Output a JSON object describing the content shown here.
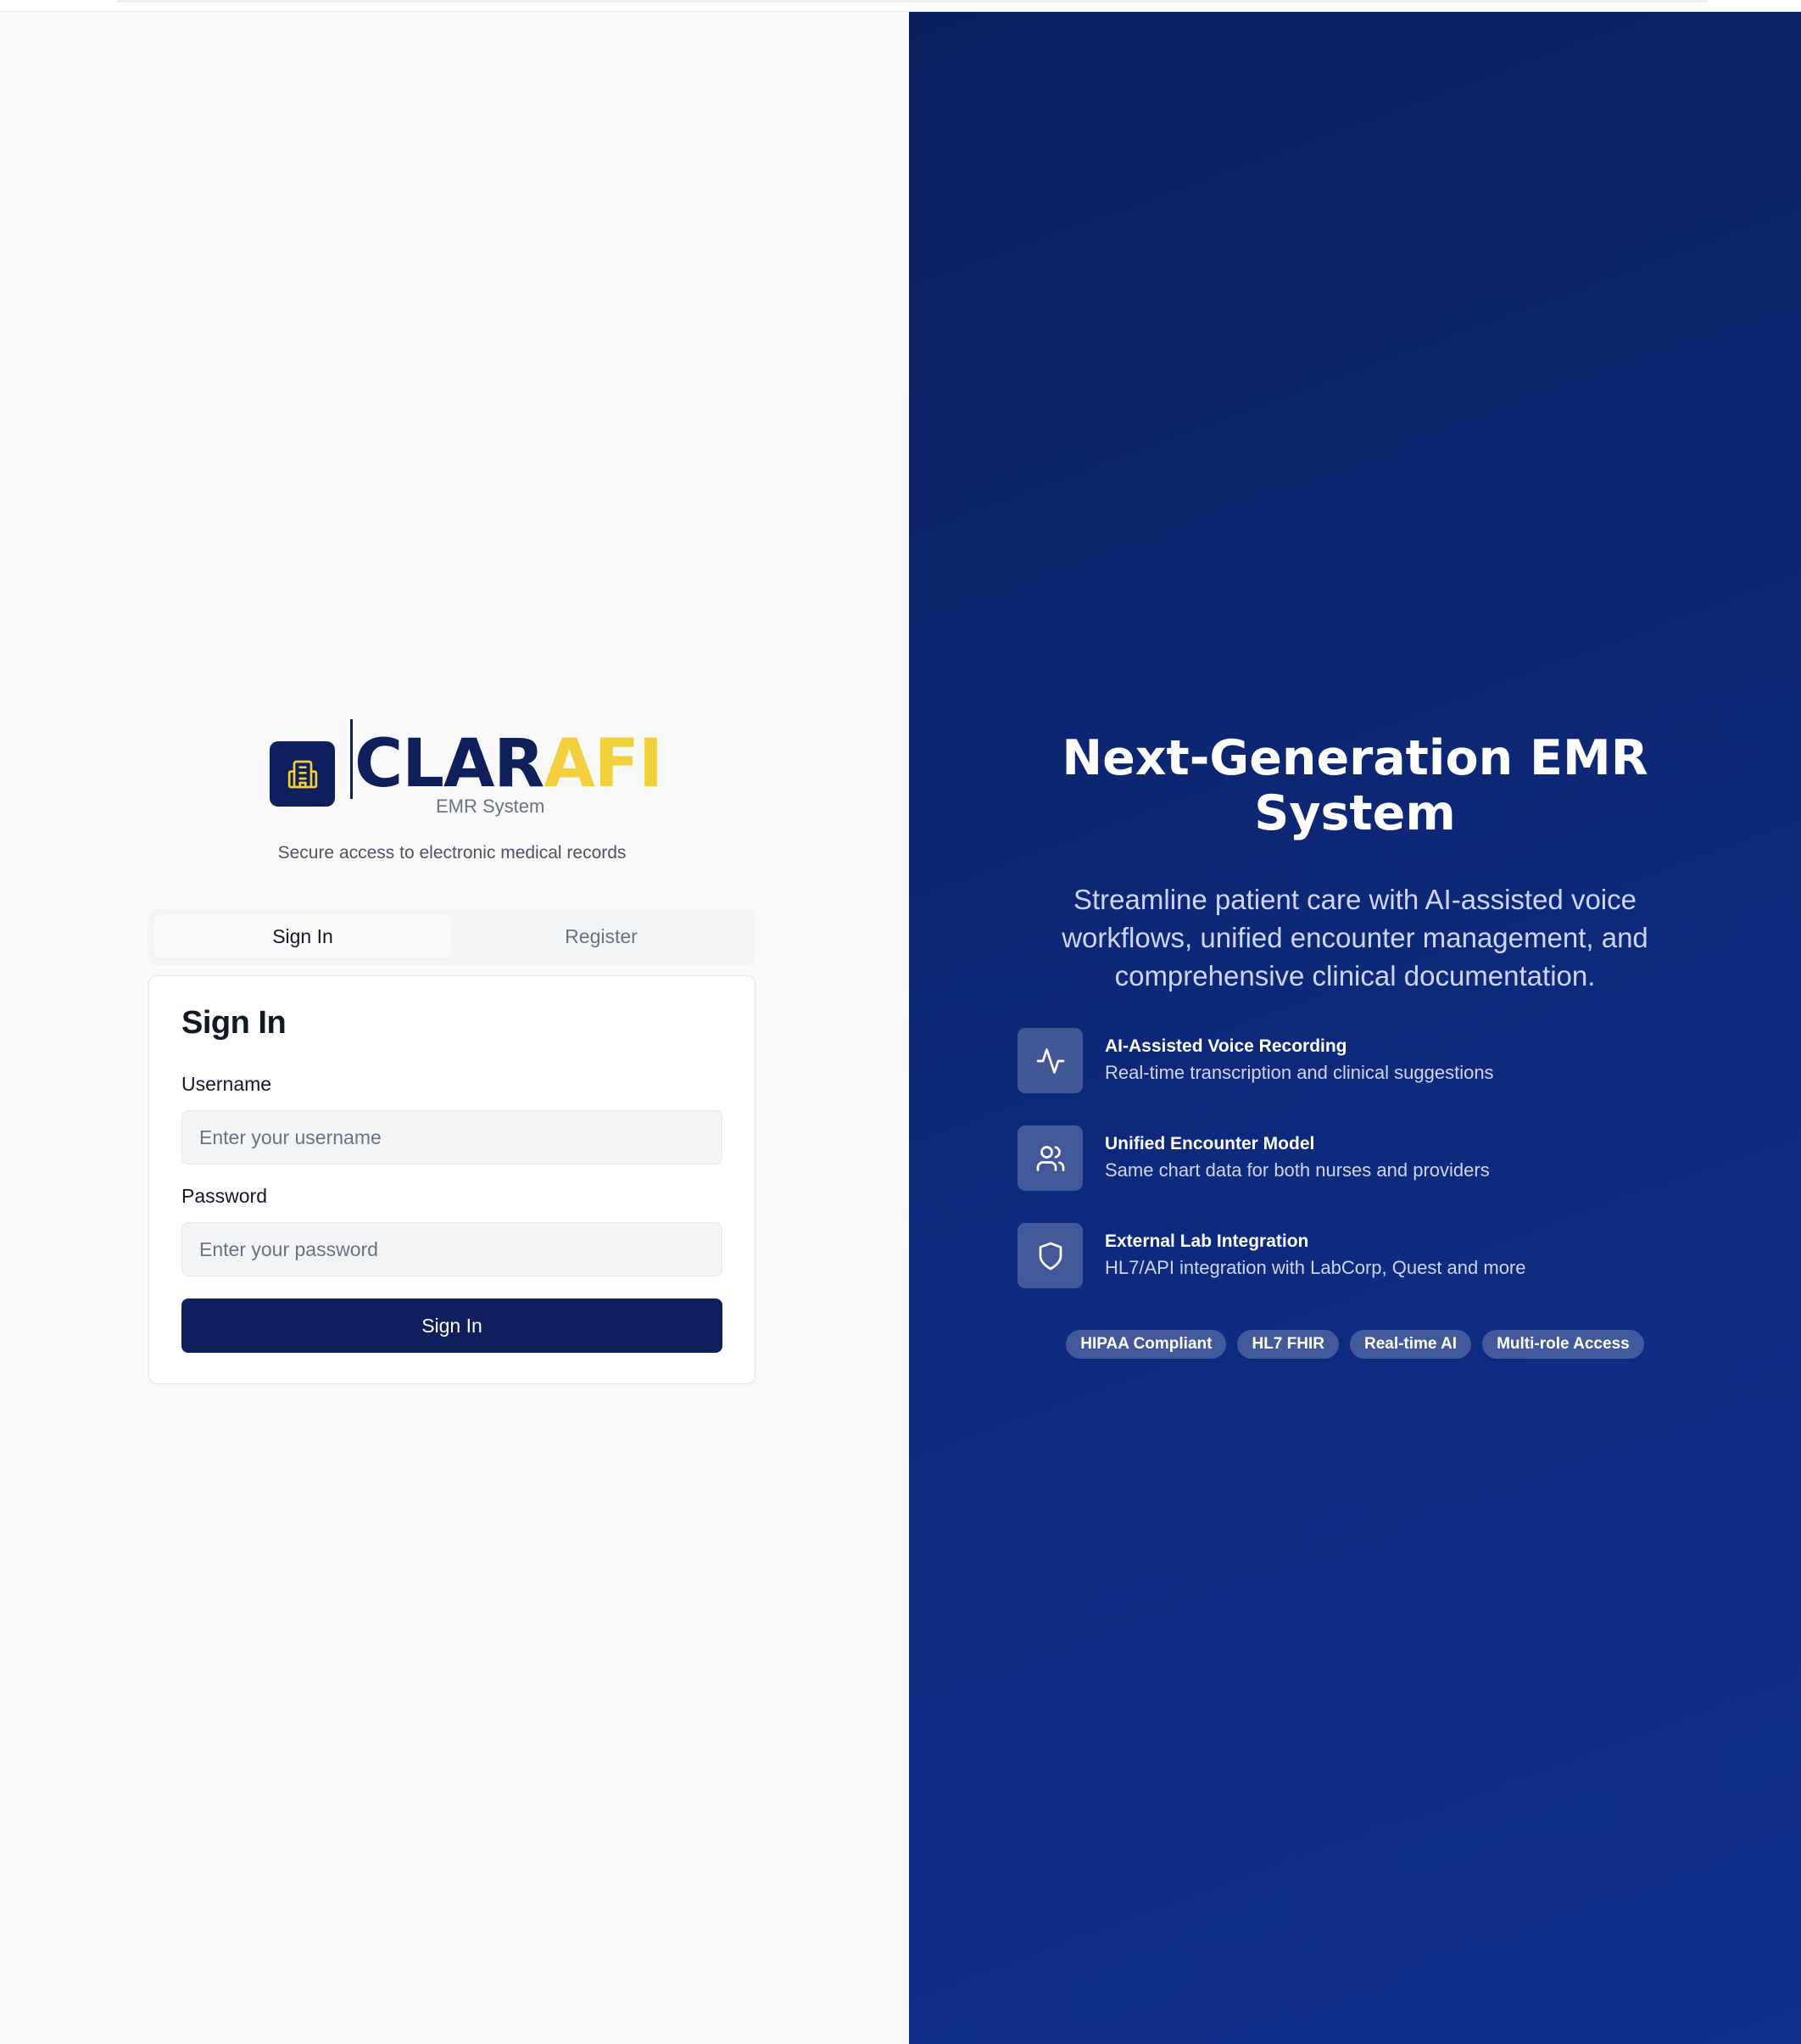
{
  "brand": {
    "name_main": "CLAR",
    "name_accent": "AFI",
    "subtitle": "EMR System",
    "primary_color": "#0f1f5c",
    "accent_color": "#f2cf3d",
    "logo_icon": "hospital-building-icon"
  },
  "tagline": "Secure access to electronic medical records",
  "tabs": [
    {
      "label": "Sign In",
      "active": true
    },
    {
      "label": "Register",
      "active": false
    }
  ],
  "signin": {
    "title": "Sign In",
    "username": {
      "label": "Username",
      "placeholder": "Enter your username",
      "value": ""
    },
    "password": {
      "label": "Password",
      "placeholder": "Enter your password",
      "value": ""
    },
    "submit_label": "Sign In"
  },
  "hero": {
    "title_line1": "Next-Generation EMR",
    "title_line2": "System",
    "description": "Streamline patient care with AI-assisted voice workflows, unified encounter management, and comprehensive clinical documentation.",
    "background_color": "#0e2a7d"
  },
  "features": [
    {
      "icon": "activity-icon",
      "title": "AI-Assisted Voice Recording",
      "description": "Real-time transcription and clinical suggestions"
    },
    {
      "icon": "users-icon",
      "title": "Unified Encounter Model",
      "description": "Same chart data for both nurses and providers"
    },
    {
      "icon": "shield-icon",
      "title": "External Lab Integration",
      "description": "HL7/API integration with LabCorp, Quest and more"
    }
  ],
  "badges": [
    "HIPAA Compliant",
    "HL7 FHIR",
    "Real-time AI",
    "Multi-role Access"
  ]
}
